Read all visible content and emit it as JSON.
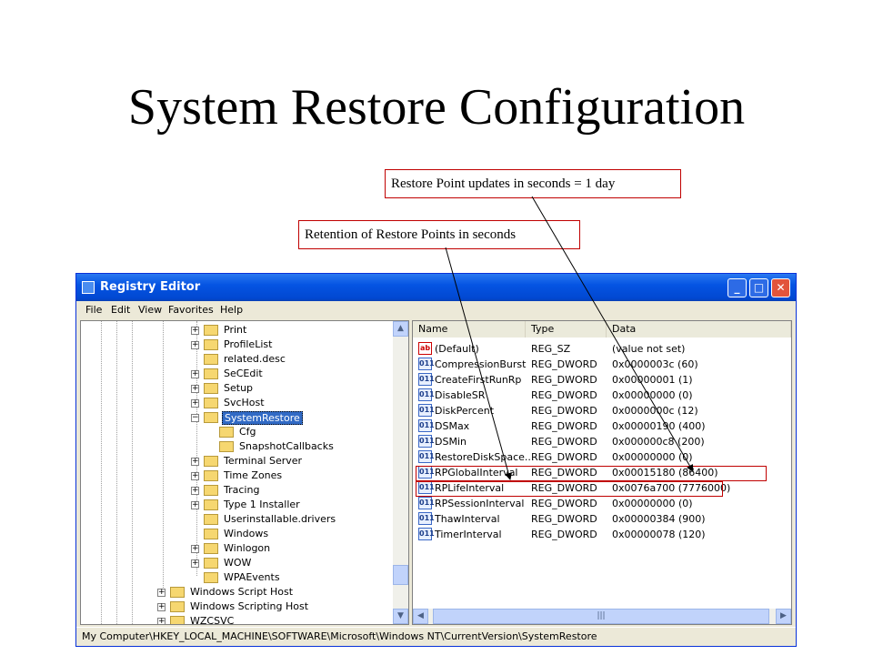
{
  "slide": {
    "title": "System Restore Configuration",
    "callouts": {
      "restore_updates": "Restore Point updates in seconds = 1 day",
      "retention": "Retention of Restore Points in seconds"
    }
  },
  "window": {
    "title": "Registry Editor",
    "menu": [
      "File",
      "Edit",
      "View",
      "Favorites",
      "Help"
    ]
  },
  "tree": {
    "items": [
      {
        "label": "Print",
        "expander": "+"
      },
      {
        "label": "ProfileList",
        "expander": "+"
      },
      {
        "label": "related.desc",
        "expander": ""
      },
      {
        "label": "SeCEdit",
        "expander": "+"
      },
      {
        "label": "Setup",
        "expander": "+"
      },
      {
        "label": "SvcHost",
        "expander": "+"
      },
      {
        "label": "SystemRestore",
        "expander": "−",
        "selected": true
      },
      {
        "label": "Cfg",
        "expander": "",
        "child": true
      },
      {
        "label": "SnapshotCallbacks",
        "expander": "",
        "child": true
      },
      {
        "label": "Terminal Server",
        "expander": "+"
      },
      {
        "label": "Time Zones",
        "expander": "+"
      },
      {
        "label": "Tracing",
        "expander": "+"
      },
      {
        "label": "Type 1 Installer",
        "expander": "+"
      },
      {
        "label": "Userinstallable.drivers",
        "expander": ""
      },
      {
        "label": "Windows",
        "expander": ""
      },
      {
        "label": "Winlogon",
        "expander": "+"
      },
      {
        "label": "WOW",
        "expander": "+"
      },
      {
        "label": "WPAEvents",
        "expander": ""
      },
      {
        "label": "Windows Script Host",
        "expander": "+",
        "outer": true
      },
      {
        "label": "Windows Scripting Host",
        "expander": "+",
        "outer": true
      },
      {
        "label": "WZCSVC",
        "expander": "+",
        "outer": true
      }
    ]
  },
  "values": {
    "headers": [
      "Name",
      "Type",
      "Data"
    ],
    "rows": [
      {
        "name": "(Default)",
        "type": "REG_SZ",
        "data": "(value not set)",
        "kind": "ab"
      },
      {
        "name": "CompressionBurst",
        "type": "REG_DWORD",
        "data": "0x0000003c (60)",
        "kind": "dw"
      },
      {
        "name": "CreateFirstRunRp",
        "type": "REG_DWORD",
        "data": "0x00000001 (1)",
        "kind": "dw"
      },
      {
        "name": "DisableSR",
        "type": "REG_DWORD",
        "data": "0x00000000 (0)",
        "kind": "dw"
      },
      {
        "name": "DiskPercent",
        "type": "REG_DWORD",
        "data": "0x0000000c (12)",
        "kind": "dw"
      },
      {
        "name": "DSMax",
        "type": "REG_DWORD",
        "data": "0x00000190 (400)",
        "kind": "dw"
      },
      {
        "name": "DSMin",
        "type": "REG_DWORD",
        "data": "0x000000c8 (200)",
        "kind": "dw"
      },
      {
        "name": "RestoreDiskSpace...",
        "type": "REG_DWORD",
        "data": "0x00000000 (0)",
        "kind": "dw"
      },
      {
        "name": "RPGlobalInterval",
        "type": "REG_DWORD",
        "data": "0x00015180 (86400)",
        "kind": "dw"
      },
      {
        "name": "RPLifeInterval",
        "type": "REG_DWORD",
        "data": "0x0076a700 (7776000)",
        "kind": "dw"
      },
      {
        "name": "RPSessionInterval",
        "type": "REG_DWORD",
        "data": "0x00000000 (0)",
        "kind": "dw"
      },
      {
        "name": "ThawInterval",
        "type": "REG_DWORD",
        "data": "0x00000384 (900)",
        "kind": "dw"
      },
      {
        "name": "TimerInterval",
        "type": "REG_DWORD",
        "data": "0x00000078 (120)",
        "kind": "dw"
      }
    ]
  },
  "statusbar": {
    "path": "My Computer\\HKEY_LOCAL_MACHINE\\SOFTWARE\\Microsoft\\Windows NT\\CurrentVersion\\SystemRestore"
  },
  "icons": {
    "string_value": "ab",
    "dword_value": "011"
  },
  "colors": {
    "titlebar": "#0554e3",
    "highlight_box": "#c00000",
    "selection": "#316ac5"
  }
}
